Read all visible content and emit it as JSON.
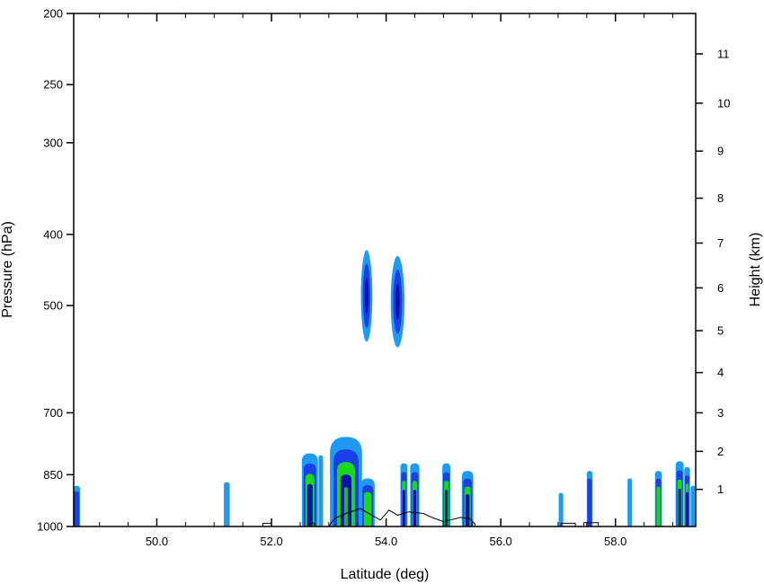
{
  "chart_data": {
    "type": "contour",
    "xlabel": "Latitude (deg)",
    "ylabel": "Pressure (hPa)",
    "y2label": "Height (km)",
    "xlim": [
      48.55,
      59.4
    ],
    "ylim": [
      1000,
      200
    ],
    "y_scale": "log",
    "x_ticks": [
      {
        "value": 50,
        "label": "50.0"
      },
      {
        "value": 52,
        "label": "52.0"
      },
      {
        "value": 54,
        "label": "54.0"
      },
      {
        "value": 56,
        "label": "56.0"
      },
      {
        "value": 58,
        "label": "58.0"
      }
    ],
    "y_ticks": [
      {
        "value": 200,
        "label": "200"
      },
      {
        "value": 250,
        "label": "250"
      },
      {
        "value": 300,
        "label": "300"
      },
      {
        "value": 400,
        "label": "400"
      },
      {
        "value": 500,
        "label": "500"
      },
      {
        "value": 700,
        "label": "700"
      },
      {
        "value": 850,
        "label": "850"
      },
      {
        "value": 1000,
        "label": "1000"
      }
    ],
    "height_ticks": [
      {
        "value": 1,
        "label": "1",
        "pressure": 890
      },
      {
        "value": 2,
        "label": "2",
        "pressure": 790
      },
      {
        "value": 3,
        "label": "3",
        "pressure": 700
      },
      {
        "value": 4,
        "label": "4",
        "pressure": 617
      },
      {
        "value": 5,
        "label": "5",
        "pressure": 541
      },
      {
        "value": 6,
        "label": "6",
        "pressure": 473
      },
      {
        "value": 7,
        "label": "7",
        "pressure": 411
      },
      {
        "value": 8,
        "label": "8",
        "pressure": 357
      },
      {
        "value": 9,
        "label": "9",
        "pressure": 308
      },
      {
        "value": 10,
        "label": "10",
        "pressure": 265
      },
      {
        "value": 11,
        "label": "11",
        "pressure": 227
      }
    ],
    "contour_colors": [
      "#1e9bf0",
      "#1a3fe6",
      "#0a12a8",
      "#1ad81a",
      "#23b23c"
    ],
    "cells": [
      {
        "lat": 48.6,
        "p_top": 880,
        "w": 0.06,
        "levels": 2
      },
      {
        "lat": 51.22,
        "p_top": 870,
        "w": 0.05,
        "levels": 1
      },
      {
        "lat": 52.67,
        "p_top": 795,
        "w": 0.14,
        "levels": 4
      },
      {
        "lat": 52.86,
        "p_top": 800,
        "w": 0.03,
        "levels": 1
      },
      {
        "lat": 53.3,
        "p_top": 755,
        "w": 0.28,
        "levels": 5
      },
      {
        "lat": 53.68,
        "p_top": 860,
        "w": 0.12,
        "levels": 3
      },
      {
        "lat": 54.31,
        "p_top": 820,
        "w": 0.06,
        "levels": 4
      },
      {
        "lat": 54.5,
        "p_top": 820,
        "w": 0.08,
        "levels": 4
      },
      {
        "lat": 55.05,
        "p_top": 820,
        "w": 0.07,
        "levels": 4
      },
      {
        "lat": 55.42,
        "p_top": 840,
        "w": 0.1,
        "levels": 4
      },
      {
        "lat": 57.05,
        "p_top": 900,
        "w": 0.03,
        "levels": 1
      },
      {
        "lat": 57.55,
        "p_top": 840,
        "w": 0.05,
        "levels": 2
      },
      {
        "lat": 58.25,
        "p_top": 860,
        "w": 0.03,
        "levels": 1
      },
      {
        "lat": 58.75,
        "p_top": 840,
        "w": 0.06,
        "levels": 3
      },
      {
        "lat": 59.12,
        "p_top": 815,
        "w": 0.07,
        "levels": 4
      },
      {
        "lat": 59.25,
        "p_top": 830,
        "w": 0.05,
        "levels": 4
      },
      {
        "lat": 59.35,
        "p_top": 880,
        "w": 0.02,
        "levels": 1
      }
    ],
    "upper_cells": [
      {
        "lat": 53.66,
        "p_top": 420,
        "p_bottom": 560,
        "w": 0.1,
        "levels": 3
      },
      {
        "lat": 54.2,
        "p_top": 428,
        "p_bottom": 570,
        "w": 0.12,
        "levels": 3
      }
    ],
    "terrain": [
      [
        51.85,
        1000
      ],
      [
        51.85,
        990
      ],
      [
        52.0,
        990
      ],
      [
        52.0,
        1000
      ],
      [
        52.65,
        1000
      ],
      [
        52.65,
        990
      ],
      [
        52.75,
        990
      ],
      [
        52.75,
        1000
      ],
      [
        53.0,
        1000
      ],
      [
        53.1,
        975
      ],
      [
        53.3,
        960
      ],
      [
        53.55,
        945
      ],
      [
        53.75,
        965
      ],
      [
        53.9,
        980
      ],
      [
        54.05,
        950
      ],
      [
        54.2,
        965
      ],
      [
        54.4,
        955
      ],
      [
        54.65,
        960
      ],
      [
        54.8,
        972
      ],
      [
        55.0,
        985
      ],
      [
        55.3,
        972
      ],
      [
        55.45,
        975
      ],
      [
        55.55,
        992
      ],
      [
        55.55,
        1000
      ],
      [
        57.05,
        1000
      ],
      [
        57.05,
        990
      ],
      [
        57.3,
        990
      ],
      [
        57.3,
        1000
      ],
      [
        57.45,
        1000
      ],
      [
        57.45,
        988
      ],
      [
        57.7,
        988
      ],
      [
        57.7,
        1000
      ]
    ]
  }
}
